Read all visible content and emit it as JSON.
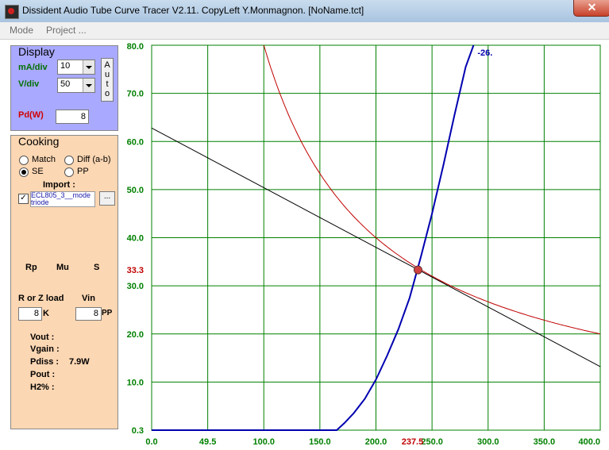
{
  "window": {
    "title": "Dissident Audio Tube Curve Tracer V2.11. CopyLeft Y.Monmagnon. [NoName.tct]",
    "close_glyph": "✕"
  },
  "menu": [
    {
      "label": "Mode"
    },
    {
      "label": "Project ..."
    }
  ],
  "display": {
    "title": "Display",
    "ma_div_label": "mA/div",
    "ma_div_value": "10",
    "v_div_label": "V/div",
    "v_div_value": "50",
    "auto_label": [
      "A",
      "u",
      "t",
      "o"
    ],
    "pd_label": "Pd(W)",
    "pd_value": "8"
  },
  "cooking": {
    "title": "Cooking",
    "match_label": "Match",
    "diff_label": "Diff (a-b)",
    "se_label": "SE",
    "pp_label": "PP",
    "mode_selected": "SE",
    "import_label": "Import :",
    "import_file": "ECL805_3__mode triode",
    "import_checked": true,
    "browse_label": "...",
    "rp_label": "Rp",
    "mu_label": "Mu",
    "s_label": "S",
    "rz_label": "R or Z load",
    "vin_label": "Vin",
    "load_value": "8",
    "load_unit": "K",
    "vin_value": "8",
    "vin_unit": "PP",
    "vout_label": "Vout :",
    "vgain_label": "Vgain :",
    "pdiss_label": "Pdiss :",
    "pdiss_value": "7.9W",
    "pout_label": "Pout :",
    "h2_label": "H2% :"
  },
  "chart_data": {
    "type": "line",
    "x_ticks": [
      "0.0",
      "49.5",
      "100.0",
      "150.0",
      "200.0",
      "250.0",
      "300.0",
      "350.0",
      "400.0"
    ],
    "y_ticks": [
      "0.3",
      "10.0",
      "20.0",
      "30.0",
      "40.0",
      "50.0",
      "60.0",
      "70.0",
      "80.0"
    ],
    "xlim": [
      0,
      400
    ],
    "ylim": [
      0,
      80
    ],
    "grid": true,
    "operating_point": {
      "x": 237.5,
      "y": 33.3,
      "x_label": "237.5",
      "y_label": "33.3"
    },
    "colors": {
      "grid": "#008000",
      "tube_curve": "#0000b0",
      "load_line": "#000000",
      "pd_hyperbola": "#c00000",
      "point": "#d04040",
      "axis_label": "#008000",
      "op_label": "#c00000"
    },
    "series": [
      {
        "key": "tube_curve",
        "label": "-26.",
        "x": [
          0,
          165,
          172,
          180,
          190,
          200,
          210,
          220,
          230,
          240,
          250,
          260,
          270,
          280,
          287
        ],
        "y": [
          0,
          0,
          1.5,
          3.5,
          6.5,
          10.5,
          15.5,
          21,
          27.5,
          36,
          45,
          55,
          65.5,
          75.5,
          80
        ]
      },
      {
        "key": "load_line",
        "x": [
          0,
          400
        ],
        "y": [
          62.8,
          13.2
        ]
      },
      {
        "key": "pd_hyperbola",
        "pd_watts": 8,
        "x_range": [
          100,
          400
        ]
      }
    ]
  }
}
